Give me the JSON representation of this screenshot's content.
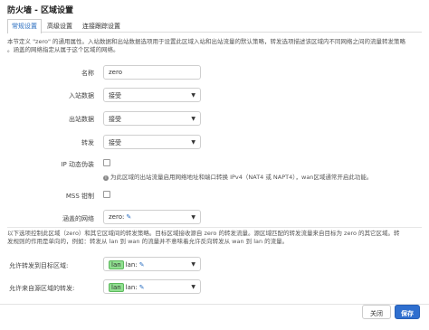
{
  "dialog": {
    "title": "防火墙 - 区域设置"
  },
  "tabs": [
    {
      "label": "常规设置",
      "active": true
    },
    {
      "label": "高级设置",
      "active": false
    },
    {
      "label": "连接跟踪设置",
      "active": false
    }
  ],
  "general": {
    "description_line1": "本节定义 \"zero\" 的通用属性。入站数据和出站数据选项用于设置此区域入站和出站流量的默认策略，转发选项描述该区域内不同网络之间的流量转发策略",
    "description_line2": "。涵盖的网络指定从属于这个区域的网络。",
    "name_label": "名称",
    "name_value": "zero",
    "input_label": "入站数据",
    "input_value": "接受",
    "output_label": "出站数据",
    "output_value": "接受",
    "forward_label": "转发",
    "forward_value": "接受",
    "masq_label": "IP 动态伪装",
    "masq_hint": "为此区域的出站流量启用网络地址和端口转换 IPv4（NAT4 或 NAPT4），wan区域通常开启此功能。",
    "mss_label": "MSS 钳制",
    "covered_label": "涵盖的网络",
    "covered_value": "zero:"
  },
  "forwarding": {
    "description_line1": "以下选项控制此区域（zero）和其它区域间的转发策略。目标区域接收源自 zero 的转发流量。源区域匹配的转发流量来自目标为 zero 的其它区域。转",
    "description_line2": "发规则的作用是单向的，例如：转发从 lan 到 wan 的流量并不意味着允许反向转发从 wan 到 lan 的流量。",
    "dest_label": "允许转发到目标区域:",
    "dest_tag": "lan",
    "dest_tag2": "lan:",
    "src_label": "允许来自源区域的转发:",
    "src_tag": "lan",
    "src_tag2": "lan:"
  },
  "footer": {
    "close_label": "关闭",
    "save_label": "保存"
  },
  "colors": {
    "accent": "#2f6fcf",
    "zone_green": "#90e090"
  },
  "icons": {
    "dropdown": "chevron-down-icon",
    "edit": "pencil-icon",
    "info": "info-icon"
  }
}
